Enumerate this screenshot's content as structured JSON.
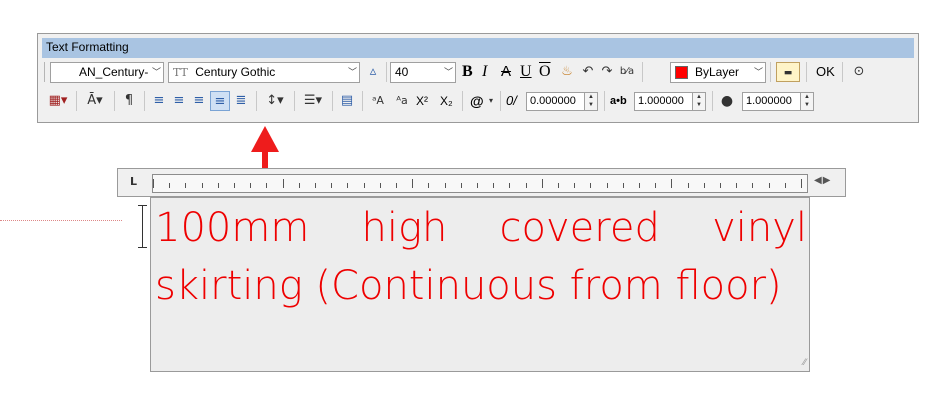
{
  "window": {
    "title": "Text Formatting"
  },
  "toolbar_row1": {
    "style_value": "AN_Century-",
    "font_value": "Century Gothic",
    "font_icon": "TT",
    "height_value": "40",
    "bold": "B",
    "italic": "I",
    "strike": "A",
    "underline": "U",
    "overline": "O",
    "color_value": "ByLayer",
    "color_hex": "#ff0000",
    "ok_label": "OK"
  },
  "toolbar_row2": {
    "oblique_value": "0.000000",
    "tracking_label": "a•b",
    "tracking_value": "1.000000",
    "width_value": "1.000000",
    "superscript": "X²",
    "subscript": "X₂",
    "symbol": "@",
    "oblique_icon": "0/"
  },
  "editor": {
    "text": "100mm high covered vinyl skirting (Continuous from floor)",
    "text_color": "#ee0000"
  },
  "ruler": {
    "tab_icon": "L",
    "arrows": "◀▶"
  },
  "accent_color": "#a9c4e2",
  "arrow_color": "#ee1c1c"
}
